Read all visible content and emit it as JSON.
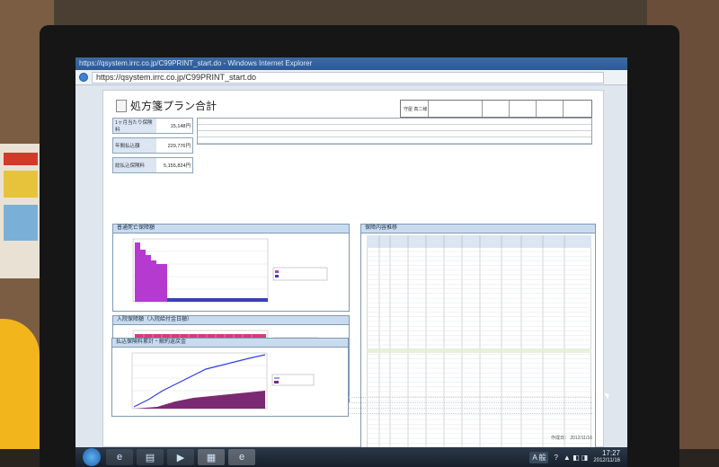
{
  "window": {
    "title": "https://qsystem.irrc.co.jp/C99PRINT_start.do - Windows Internet Explorer",
    "address": "https://qsystem.irrc.co.jp/C99PRINT_start.do"
  },
  "document": {
    "title": "処方箋プラン合計",
    "header_name": "守屋 真二様",
    "summary": [
      {
        "label": "1ヶ月当たり保険料",
        "value": "15,148円"
      },
      {
        "label": "年間払込額",
        "value": "229,776円"
      },
      {
        "label": "総払込保険料",
        "value": "5,155,824円"
      }
    ],
    "panels": {
      "death": "普通死亡保障額",
      "hospital": "入院保障額（入院給付金日額）",
      "savings": "払込保険料累計・解約返戻金",
      "table": "保障内容推移"
    },
    "footer_stamp": "作成日： 2012/11/16"
  },
  "taskbar": {
    "ime_label": "A 般",
    "time": "17:27",
    "date": "2012/11/16"
  },
  "colors": {
    "death_bar": "#b43ad0",
    "hospital_bar_1": "#d63a7d",
    "hospital_bar_2": "#3a8ad6",
    "savings_line": "#2e3fe0",
    "savings_area": "#7a2a72"
  }
}
